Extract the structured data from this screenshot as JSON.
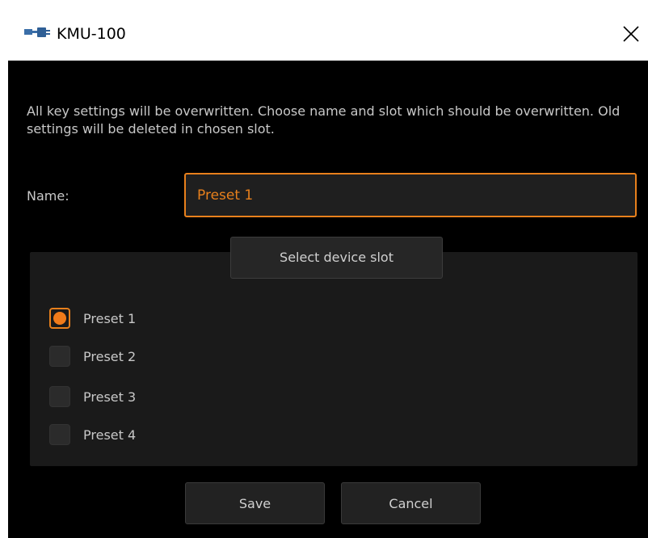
{
  "window": {
    "title": "KMU-100",
    "app_icon": "device-plug-icon",
    "close_icon": "close-icon"
  },
  "dialog": {
    "message": "All key settings will be overwritten. Choose name and slot which should be overwritten. Old settings will be deleted in chosen slot.",
    "name_label": "Name:",
    "name_value": "Preset 1",
    "slot_header": "Select device slot",
    "slots": [
      {
        "label": "Preset 1",
        "selected": true
      },
      {
        "label": "Preset 2",
        "selected": false
      },
      {
        "label": "Preset 3",
        "selected": false
      },
      {
        "label": "Preset 4",
        "selected": false
      }
    ],
    "save_label": "Save",
    "cancel_label": "Cancel"
  },
  "colors": {
    "accent": "#e8801c",
    "background": "#000000",
    "panel": "#1a1a1a",
    "text": "#c8c8c8"
  }
}
